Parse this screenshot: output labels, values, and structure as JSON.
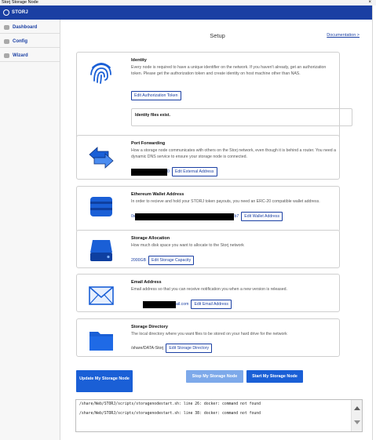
{
  "window": {
    "title": "Storj Storage Node",
    "close_glyph": "×"
  },
  "app": {
    "brand": "STORJ",
    "accent": "#1a3fa3"
  },
  "sidebar": {
    "items": [
      {
        "label": "Dashboard",
        "icon": "dashboard-icon"
      },
      {
        "label": "Config",
        "icon": "config-icon"
      },
      {
        "label": "Wizard",
        "icon": "wizard-icon"
      }
    ]
  },
  "page": {
    "title": "Setup",
    "doc_link": "Documentation >"
  },
  "identity": {
    "heading": "Identity",
    "description": "Every node is required to have a unique identifier on the network. If you haven't already, get an authorization token. Please get the authorization token and create identity on host machine other than NAS.",
    "button": "Edit Authorization Token",
    "status": "Identity files exist.",
    "icon": "fingerprint-icon"
  },
  "port": {
    "heading": "Port Forwarding",
    "description": "How a storage node communicates with others on the Storj network, even though it is behind a router. You need a dynamic DNS service to ensure your storage node is connected.",
    "value_suffix": "0",
    "button": "Edit External Address",
    "icon": "port-forward-icon"
  },
  "wallet": {
    "heading": "Ethereum Wallet Address",
    "description": "In order to recieve and hold your STORJ token payouts, you need an ERC-20 compatible wallet address.",
    "value_prefix": "0x",
    "value_suffix": "b7",
    "button": "Edit Wallet Address",
    "icon": "wallet-icon"
  },
  "storage": {
    "heading": "Storage Allocation",
    "description": "How much disk space you want to allocate to the Storj network",
    "value": "2000GB",
    "button": "Edit Storage Capacity",
    "icon": "hard-drive-icon"
  },
  "email": {
    "heading": "Email Address",
    "description": "Email address so that you can receive notification you when a new version is released.",
    "value_suffix": "ail.com",
    "button": "Edit Email Address",
    "icon": "envelope-icon"
  },
  "directory": {
    "heading": "Storage Directory",
    "description": "The local directory where you want files to be stored on your hard drive for the network",
    "value": "/share/DATA-Storj",
    "button": "Edit Storage Directory",
    "icon": "folder-icon"
  },
  "actions": {
    "update": "Update My Storage Node",
    "stop": "Stop My Storage Node",
    "start": "Start My Storage Node"
  },
  "log": {
    "lines": [
      "/share/Web/STORJ/scripts/storagenodestart.sh: line 26: docker: command not found",
      "/share/Web/STORJ/scripts/storagenodestart.sh: line 38: docker: command not found"
    ]
  }
}
